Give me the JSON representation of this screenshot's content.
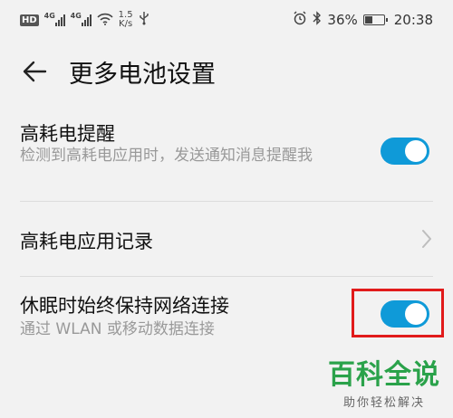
{
  "status_bar": {
    "hd": "HD",
    "net1": "4G",
    "net2": "4G",
    "speed_value": "1.5",
    "speed_unit": "K/s",
    "battery_percent": "36%",
    "battery_level": 0.36,
    "time": "20:38"
  },
  "header": {
    "title": "更多电池设置"
  },
  "items": [
    {
      "title": "高耗电提醒",
      "subtitle": "检测到高耗电应用时，发送通知消息提醒我",
      "toggle_on": true
    },
    {
      "title": "高耗电应用记录"
    },
    {
      "title": "休眠时始终保持网络连接",
      "subtitle": "通过 WLAN 或移动数据连接",
      "toggle_on": true
    }
  ],
  "watermark": {
    "main": "百科全说",
    "sub": "助你轻松解决"
  },
  "colors": {
    "toggle_on": "#0f9ad8",
    "highlight": "#e11b1b",
    "watermark": "#2aa24a",
    "background": "#f2f2f2"
  }
}
